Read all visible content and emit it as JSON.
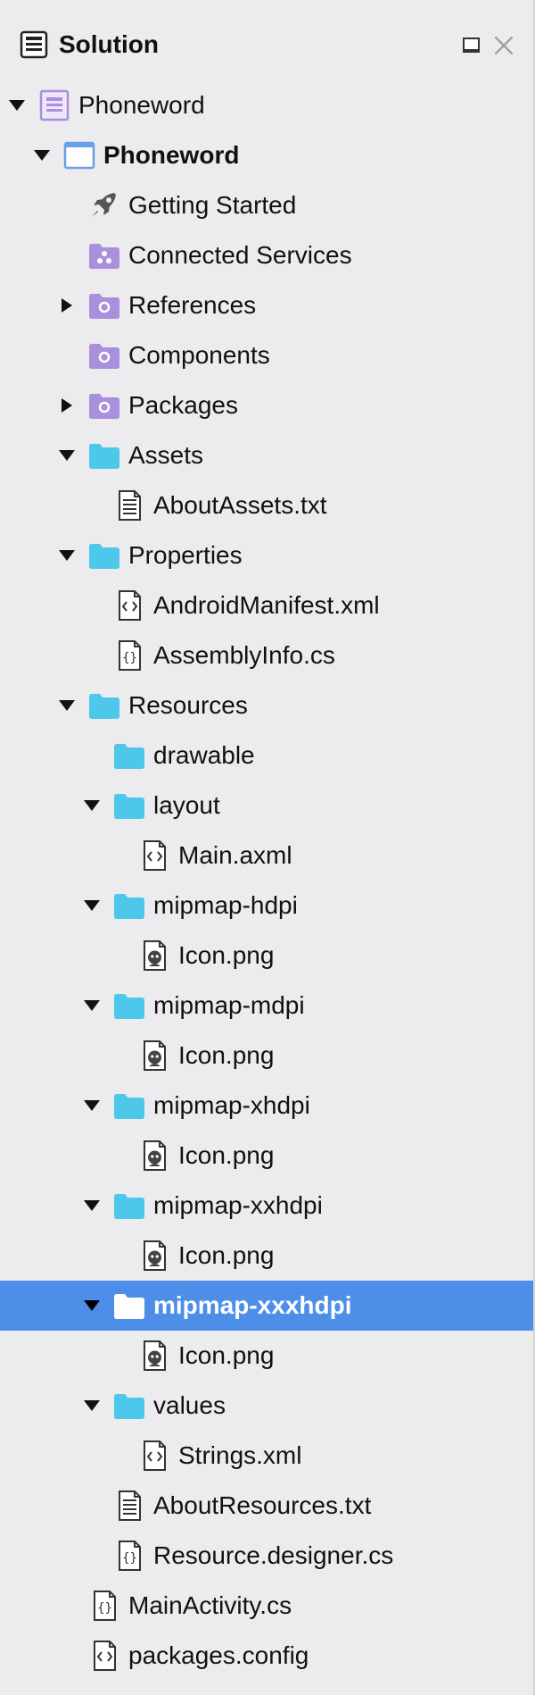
{
  "header": {
    "title": "Solution",
    "icons": [
      "solution-icon",
      "pad-icon",
      "close-icon"
    ]
  },
  "colors": {
    "folder": "#4dc8ea",
    "purple": "#a98fdc",
    "selection": "#4d8ee9",
    "background": "#ececee"
  },
  "tree": [
    {
      "label": "Phoneword",
      "depth": 0,
      "expanded": true,
      "icon": "solution-file-icon"
    },
    {
      "label": "Phoneword",
      "depth": 1,
      "expanded": true,
      "icon": "project-window-icon",
      "bold": true
    },
    {
      "label": "Getting Started",
      "depth": 2,
      "icon": "rocket-icon"
    },
    {
      "label": "Connected Services",
      "depth": 2,
      "icon": "services-folder-icon"
    },
    {
      "label": "References",
      "depth": 2,
      "expanded": false,
      "icon": "references-folder-icon"
    },
    {
      "label": "Components",
      "depth": 2,
      "icon": "components-folder-icon"
    },
    {
      "label": "Packages",
      "depth": 2,
      "expanded": false,
      "icon": "packages-folder-icon"
    },
    {
      "label": "Assets",
      "depth": 2,
      "expanded": true,
      "icon": "folder-icon"
    },
    {
      "label": "AboutAssets.txt",
      "depth": 3,
      "icon": "text-file-icon"
    },
    {
      "label": "Properties",
      "depth": 2,
      "expanded": true,
      "icon": "folder-icon"
    },
    {
      "label": "AndroidManifest.xml",
      "depth": 3,
      "icon": "xml-file-icon"
    },
    {
      "label": "AssemblyInfo.cs",
      "depth": 3,
      "icon": "cs-file-icon"
    },
    {
      "label": "Resources",
      "depth": 2,
      "expanded": true,
      "icon": "folder-icon"
    },
    {
      "label": "drawable",
      "depth": 3,
      "icon": "folder-icon"
    },
    {
      "label": "layout",
      "depth": 3,
      "expanded": true,
      "icon": "folder-icon"
    },
    {
      "label": "Main.axml",
      "depth": 4,
      "icon": "xml-file-icon"
    },
    {
      "label": "mipmap-hdpi",
      "depth": 3,
      "expanded": true,
      "icon": "folder-icon"
    },
    {
      "label": "Icon.png",
      "depth": 4,
      "icon": "image-file-icon"
    },
    {
      "label": "mipmap-mdpi",
      "depth": 3,
      "expanded": true,
      "icon": "folder-icon"
    },
    {
      "label": "Icon.png",
      "depth": 4,
      "icon": "image-file-icon"
    },
    {
      "label": "mipmap-xhdpi",
      "depth": 3,
      "expanded": true,
      "icon": "folder-icon"
    },
    {
      "label": "Icon.png",
      "depth": 4,
      "icon": "image-file-icon"
    },
    {
      "label": "mipmap-xxhdpi",
      "depth": 3,
      "expanded": true,
      "icon": "folder-icon"
    },
    {
      "label": "Icon.png",
      "depth": 4,
      "icon": "image-file-icon"
    },
    {
      "label": "mipmap-xxxhdpi",
      "depth": 3,
      "expanded": true,
      "icon": "folder-icon",
      "selected": true
    },
    {
      "label": "Icon.png",
      "depth": 4,
      "icon": "image-file-icon"
    },
    {
      "label": "values",
      "depth": 3,
      "expanded": true,
      "icon": "folder-icon"
    },
    {
      "label": "Strings.xml",
      "depth": 4,
      "icon": "xml-file-icon"
    },
    {
      "label": "AboutResources.txt",
      "depth": 3,
      "icon": "text-file-icon"
    },
    {
      "label": "Resource.designer.cs",
      "depth": 3,
      "icon": "cs-file-icon"
    },
    {
      "label": "MainActivity.cs",
      "depth": 2,
      "icon": "cs-file-icon"
    },
    {
      "label": "packages.config",
      "depth": 2,
      "icon": "xml-file-icon"
    }
  ]
}
